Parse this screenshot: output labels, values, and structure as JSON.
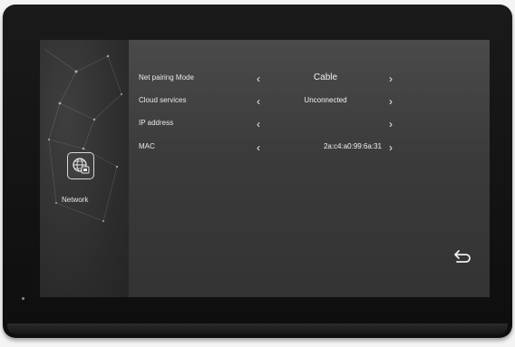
{
  "sidebar": {
    "network_label": "Network",
    "network_icon": "globe-network-icon"
  },
  "settings": {
    "rows": [
      {
        "label": "Net pairing Mode",
        "value": "Cable"
      },
      {
        "label": "Cloud services",
        "value": "Unconnected"
      },
      {
        "label": "IP address",
        "value": ""
      },
      {
        "label": "MAC",
        "value": "2a:c4:a0:99:6a:31"
      }
    ]
  },
  "icons": {
    "left_arrow": "‹",
    "right_arrow": "›",
    "back": "return-arrow-icon"
  },
  "colors": {
    "screen_bg": "#3a3a3a",
    "text": "#eaeaea",
    "bezel": "#141414"
  }
}
